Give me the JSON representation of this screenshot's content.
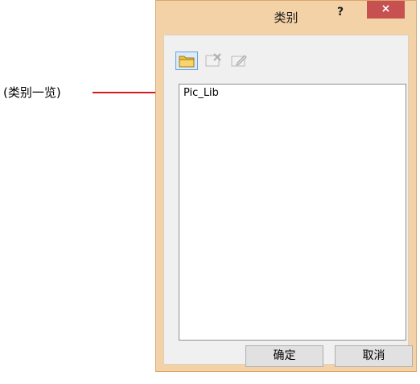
{
  "callout": {
    "label": "(类别一览)",
    "line_color": "#d11c1c"
  },
  "dialog": {
    "title": "类别",
    "help_label": "?",
    "close_label": "×",
    "frame_color": "#f4d2a8",
    "close_color": "#c75050",
    "toolbar": [
      {
        "name": "new-category-button",
        "icon": "folder-icon",
        "enabled": true
      },
      {
        "name": "delete-category-button",
        "icon": "delete-icon",
        "enabled": false
      },
      {
        "name": "edit-category-button",
        "icon": "edit-icon",
        "enabled": false
      }
    ],
    "category_list": {
      "items": [
        "Pic_Lib"
      ]
    },
    "buttons": {
      "ok_label": "确定",
      "cancel_label": "取消"
    }
  }
}
